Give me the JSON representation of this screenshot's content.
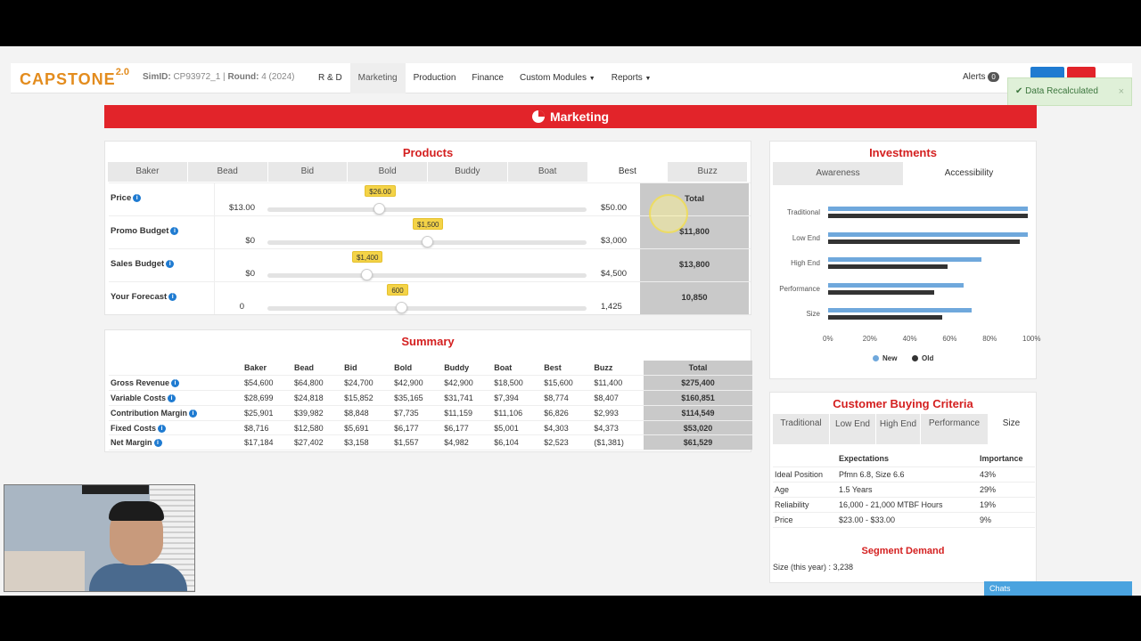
{
  "brand": {
    "name": "CAPSTONE",
    "version": "2.0"
  },
  "sim": {
    "simid_label": "SimID:",
    "simid": "CP93972_1 |",
    "round_label": "Round:",
    "round": "4 (2024)"
  },
  "nav": [
    {
      "label": "R & D"
    },
    {
      "label": "Marketing",
      "active": true
    },
    {
      "label": "Production"
    },
    {
      "label": "Finance"
    },
    {
      "label": "Custom Modules",
      "dropdown": true
    },
    {
      "label": "Reports",
      "dropdown": true
    }
  ],
  "alerts": {
    "label": "Alerts",
    "count": "0"
  },
  "toast": {
    "text": "Data Recalculated",
    "close": "×"
  },
  "banner": {
    "title": "Marketing"
  },
  "products": {
    "title": "Products",
    "tabs": [
      "Baker",
      "Bead",
      "Bid",
      "Bold",
      "Buddy",
      "Boat",
      "Best",
      "Buzz"
    ],
    "active_tab": "Best",
    "total_label": "Total",
    "rows": [
      {
        "label": "Price",
        "min": "$13.00",
        "max": "$50.00",
        "value": "$26.00",
        "fraction": 0.35,
        "total": ""
      },
      {
        "label": "Promo Budget",
        "min": "$0",
        "max": "$3,000",
        "value": "$1,500",
        "fraction": 0.5,
        "total": "$11,800"
      },
      {
        "label": "Sales Budget",
        "min": "$0",
        "max": "$4,500",
        "value": "$1,400",
        "fraction": 0.31,
        "total": "$13,800"
      },
      {
        "label": "Your Forecast",
        "min": "0",
        "max": "1,425",
        "value": "600",
        "fraction": 0.42,
        "total": "10,850"
      }
    ]
  },
  "summary": {
    "title": "Summary",
    "columns": [
      "Baker",
      "Bead",
      "Bid",
      "Bold",
      "Buddy",
      "Boat",
      "Best",
      "Buzz",
      "Total"
    ],
    "rows": [
      {
        "label": "Gross Revenue",
        "values": [
          "$54,600",
          "$64,800",
          "$24,700",
          "$42,900",
          "$42,900",
          "$18,500",
          "$15,600",
          "$11,400",
          "$275,400"
        ]
      },
      {
        "label": "Variable Costs",
        "values": [
          "$28,699",
          "$24,818",
          "$15,852",
          "$35,165",
          "$31,741",
          "$7,394",
          "$8,774",
          "$8,407",
          "$160,851"
        ]
      },
      {
        "label": "Contribution Margin",
        "values": [
          "$25,901",
          "$39,982",
          "$8,848",
          "$7,735",
          "$11,159",
          "$11,106",
          "$6,826",
          "$2,993",
          "$114,549"
        ]
      },
      {
        "label": "Fixed Costs",
        "values": [
          "$8,716",
          "$12,580",
          "$5,691",
          "$6,177",
          "$6,177",
          "$5,001",
          "$4,303",
          "$4,373",
          "$53,020"
        ]
      },
      {
        "label": "Net Margin",
        "values": [
          "$17,184",
          "$27,402",
          "$3,158",
          "$1,557",
          "$4,982",
          "$6,104",
          "$2,523",
          "($1,381)",
          "$61,529"
        ]
      }
    ]
  },
  "investments": {
    "title": "Investments",
    "tabs": [
      "Awareness",
      "Accessibility"
    ],
    "active_tab": "Accessibility",
    "chart_data": {
      "type": "bar",
      "orientation": "horizontal",
      "categories": [
        "Traditional",
        "Low End",
        "High End",
        "Performance",
        "Size"
      ],
      "series": [
        {
          "name": "New",
          "color": "#6fa8dc",
          "values": [
            100,
            100,
            77,
            68,
            72
          ]
        },
        {
          "name": "Old",
          "color": "#333333",
          "values": [
            100,
            96,
            60,
            53,
            57
          ]
        }
      ],
      "xticks": [
        "0%",
        "20%",
        "40%",
        "60%",
        "80%",
        "100%"
      ],
      "xlim": [
        0,
        100
      ],
      "legend": "bottom"
    }
  },
  "cbc": {
    "title": "Customer Buying Criteria",
    "tabs": [
      "Traditional",
      "Low End",
      "High End",
      "Performance",
      "Size"
    ],
    "active_tab": "Size",
    "headers": [
      "",
      "Expectations",
      "Importance"
    ],
    "rows": [
      {
        "label": "Ideal Position",
        "expectation": "Pfmn 6.8, Size 6.6",
        "importance": "43%"
      },
      {
        "label": "Age",
        "expectation": "1.5 Years",
        "importance": "29%"
      },
      {
        "label": "Reliability",
        "expectation": "16,000 - 21,000 MTBF Hours",
        "importance": "19%"
      },
      {
        "label": "Price",
        "expectation": "$23.00 - $33.00",
        "importance": "9%"
      }
    ],
    "demand_title": "Segment Demand",
    "demand_text": "Size (this year) : 3,238"
  },
  "chats": {
    "label": "Chats"
  }
}
